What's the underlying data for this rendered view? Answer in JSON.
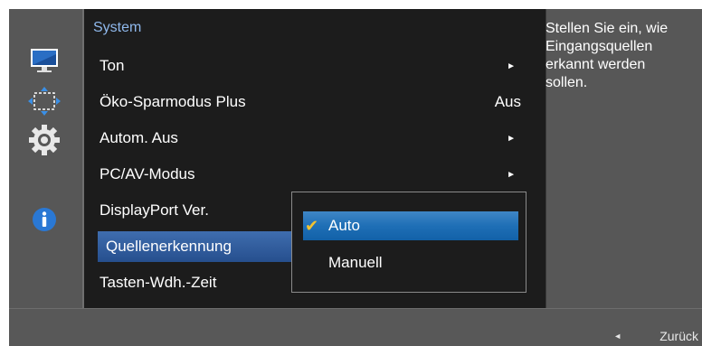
{
  "menu": {
    "title": "System",
    "items": [
      {
        "label": "Ton",
        "value": "",
        "chevron": true
      },
      {
        "label": "Öko-Sparmodus Plus",
        "value": "Aus",
        "chevron": false
      },
      {
        "label": "Autom. Aus",
        "value": "",
        "chevron": true
      },
      {
        "label": "PC/AV-Modus",
        "value": "",
        "chevron": true
      },
      {
        "label": "DisplayPort Ver.",
        "value": "",
        "chevron": false
      },
      {
        "label": "Quellenerkennung",
        "value": "",
        "chevron": false
      },
      {
        "label": "Tasten-Wdh.-Zeit",
        "value": "",
        "chevron": false
      }
    ],
    "chevron_glyph": "►"
  },
  "submenu": {
    "options": [
      {
        "label": "Auto",
        "selected": true
      },
      {
        "label": "Manuell",
        "selected": false
      }
    ],
    "check_glyph": "✔"
  },
  "help_text": "Stellen Sie ein, wie Eingangsquellen erkannt werden sollen.",
  "footer": {
    "back_label": "Zurück",
    "back_arrow": "◄"
  },
  "sidebar": {
    "icons": [
      "monitor-icon",
      "resize-icon",
      "gear-icon",
      "info-icon"
    ]
  },
  "colors": {
    "accent_text": "#8fb8ec",
    "selected_item": "#264f8e",
    "highlight_option": "#1f6fb6",
    "checkmark": "#f2c230"
  }
}
